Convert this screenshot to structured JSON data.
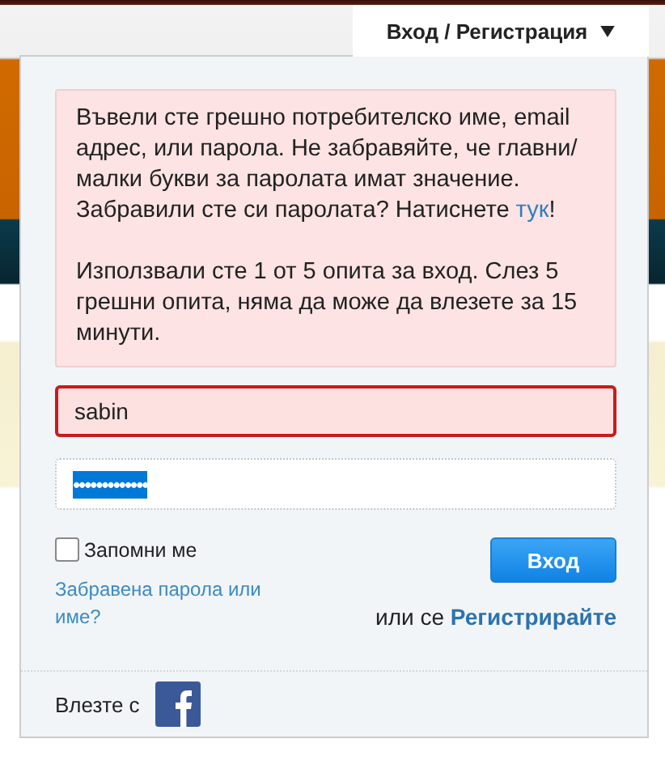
{
  "menu_tab": {
    "label": "Вход / Регистрация",
    "expanded": true
  },
  "alert": {
    "text": "Въвели сте грешно потребителско име, email адрес, или парола. Не забравяйте, че главни/малки букви за паролата имат значение. Забравили сте си паролата? Натиснете ",
    "link": "тук",
    "after": "!",
    "attempts": "Използвали сте 1 от 5 опита за вход. Слез 5 грешни опита, няма да може да влезете за 15 минути."
  },
  "username": {
    "value": "sabin",
    "error": true
  },
  "password": {
    "value": "•••••••••••••",
    "selected": true
  },
  "remember": {
    "label": "Запомни ме",
    "checked": false
  },
  "login_button": "Вход",
  "forgot_link": "Забравена парола или име?",
  "register": {
    "prefix": "или се",
    "link": "Регистрирайте"
  },
  "social": {
    "label": "Влезте с"
  }
}
